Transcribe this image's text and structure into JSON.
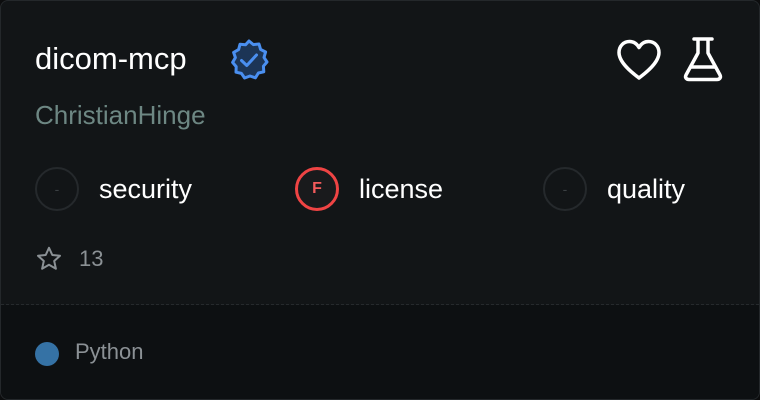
{
  "repo": {
    "name": "dicom-mcp",
    "author": "ChristianHinge",
    "verified_icon": "verified-badge-icon",
    "accent_color": "#3b82f6"
  },
  "actions": {
    "favorite_icon": "heart-icon",
    "test_icon": "flask-icon"
  },
  "metrics": [
    {
      "grade": "-",
      "label": "security",
      "status": "none"
    },
    {
      "grade": "F",
      "label": "license",
      "status": "fail",
      "color": "#ef4444"
    },
    {
      "grade": "-",
      "label": "quality",
      "status": "none"
    }
  ],
  "stars": {
    "icon": "star-icon",
    "count": "13"
  },
  "language": {
    "name": "Python",
    "color": "#3572A5"
  }
}
